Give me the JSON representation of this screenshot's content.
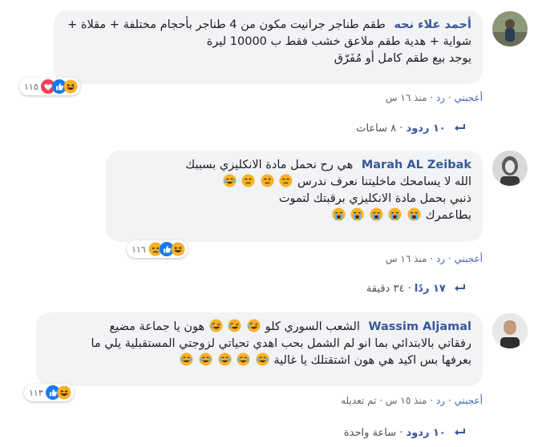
{
  "comments": [
    {
      "author": "أحمد علاء نحه",
      "lines": [
        "طقم طناجر جرانيت مكون من 4 طناجر بأحجام مختلفة + مقلاة +",
        "شواية + هدية طقم ملاعق خشب فقط ب 10000 ليرة",
        "يوجد بيع طقم كامل أو مُفَرّق"
      ],
      "reaction_count": "١١٥",
      "reaction_icons": [
        "haha-icon",
        "like-icon",
        "love-icon"
      ],
      "like_label": "أعجبني",
      "reply_label": "رد",
      "time": "منذ ١٦ س",
      "replies_count": "١٠ ردود",
      "replies_time": "٨ ساعات"
    },
    {
      "author": "Marah AL Zeibak",
      "lines": [
        "هي رح نحمل مادة الانكليزي بسببك",
        "الله لا يسامحك ماخليتنا نعرف ندرس",
        "ذنبي بحمل مادة الانكليزي برقبتك لتموت",
        "بطاعمرك"
      ],
      "reaction_count": "١١٦",
      "reaction_icons": [
        "haha-icon",
        "like-icon",
        "sad-icon"
      ],
      "like_label": "أعجبني",
      "reply_label": "رد",
      "time": "منذ ١٦ س",
      "replies_count": "١٧ ردًا",
      "replies_time": "٣٤ دقيقة"
    },
    {
      "author": "Wassim Aljamal",
      "lines": [
        "الشعب السوري كلو",
        "هون يا جماعة مضيع",
        "رفقاتي بالابتدائي بما انو لم الشمل بحب اهدي تحياتي لزوجتي المستقبلية يلي ما",
        "بعرفها بس اكيد هي هون اشتقتلك يا غالية"
      ],
      "reaction_count": "١١٣",
      "reaction_icons": [
        "haha-icon",
        "like-icon"
      ],
      "like_label": "أعجبني",
      "reply_label": "رد",
      "time": "منذ ١٥ س",
      "edited_label": "تم تعديله",
      "replies_count": "١٠ ردود",
      "replies_time": "ساعة واحدة"
    }
  ],
  "colors": {
    "link": "#385898",
    "bubble": "#f2f3f5",
    "meta": "#606770",
    "like": "#1877f2",
    "love": "#f33e58",
    "emoji": "#f7b125"
  }
}
